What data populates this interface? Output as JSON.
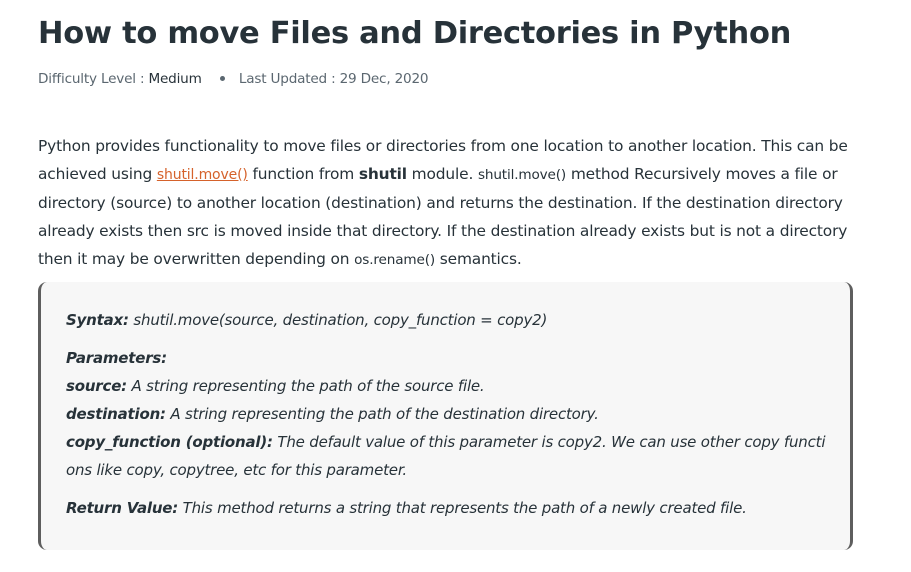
{
  "article": {
    "title": "How to move Files and Directories in Python",
    "meta": {
      "difficulty_label": "Difficulty Level : ",
      "difficulty_value": "Medium",
      "updated_label": "Last Updated : ",
      "updated_value": "29 Dec, 2020"
    },
    "intro": {
      "line1": "Python provides functionality to move files or directories from one location to another location. This can be",
      "line2_pre": "achieved using ",
      "line2_link": "shutil.move()",
      "line2_mid": " function from ",
      "line2_bold": "shutil",
      "line2_post1": " module. ",
      "line2_code": "shutil.move()",
      "line2_post2": " method Recursively moves a file or",
      "line3": "directory (source) to another location (destination) and returns the destination. If the destination directory",
      "line4": "already exists then src is moved inside that directory. If the destination already exists but is not a directory",
      "line5_pre": "then it may be overwritten depending on ",
      "line5_code": "os.rename()",
      "line5_post": " semantics."
    },
    "syntax_box": {
      "syntax_label": "Syntax:",
      "syntax_value": " shutil.move(source, destination, copy_function = copy2)",
      "parameters_label": "Parameters:",
      "params": [
        {
          "name": "source:",
          "desc": " A string representing the path of the source file."
        },
        {
          "name": "destination:",
          "desc": " A string representing the path of the destination directory."
        },
        {
          "name": "copy_function (optional):",
          "desc": " The default value of this parameter is copy2. We can use other copy functi"
        }
      ],
      "param_continuation": "ons like copy, copytree, etc for this parameter.",
      "return_label": "Return Value:",
      "return_value": " This method returns a string that represents the path of a newly created file."
    },
    "colors": {
      "text": "#273239",
      "link": "#d5622b",
      "box_bg": "#f7f7f7",
      "box_border": "#5e5e5e",
      "meta_text": "#5b6770"
    }
  }
}
